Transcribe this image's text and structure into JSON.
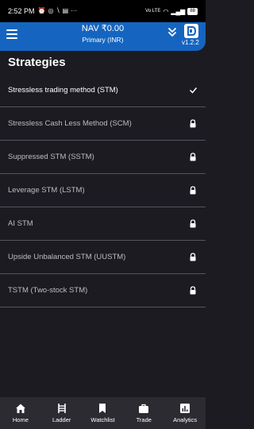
{
  "status_bar": {
    "time": "2:52 PM",
    "signal": "Vo LTE",
    "battery": "88"
  },
  "app_bar": {
    "title": "NAV ₹0.00",
    "subtitle": "Primary (INR)",
    "version": "v1.2.2",
    "menu_icon": "hamburger-menu-icon",
    "expand_icon": "double-chevron-down-icon",
    "logo_icon": "app-logo-icon"
  },
  "page": {
    "title": "Strategies"
  },
  "strategies": [
    {
      "label": "Stressless trading method (STM)",
      "state": "selected"
    },
    {
      "label": "Stressless Cash Less Method (SCM)",
      "state": "locked"
    },
    {
      "label": "Suppressed STM (SSTM)",
      "state": "locked"
    },
    {
      "label": "Leverage STM (LSTM)",
      "state": "locked"
    },
    {
      "label": "AI STM",
      "state": "locked"
    },
    {
      "label": "Upside Unbalanced STM (UUSTM)",
      "state": "locked"
    },
    {
      "label": "TSTM (Two-stock STM)",
      "state": "locked"
    }
  ],
  "bottom_nav": [
    {
      "label": "Home",
      "icon": "home-icon"
    },
    {
      "label": "Ladder",
      "icon": "ladder-icon"
    },
    {
      "label": "Watchlist",
      "icon": "bookmark-icon"
    },
    {
      "label": "Trade",
      "icon": "briefcase-icon"
    },
    {
      "label": "Analytics",
      "icon": "analytics-icon"
    }
  ],
  "colors": {
    "background": "#1c1b21",
    "app_bar": "#1565c0",
    "bottom_nav": "#2c2b32",
    "divider": "#55545c"
  }
}
